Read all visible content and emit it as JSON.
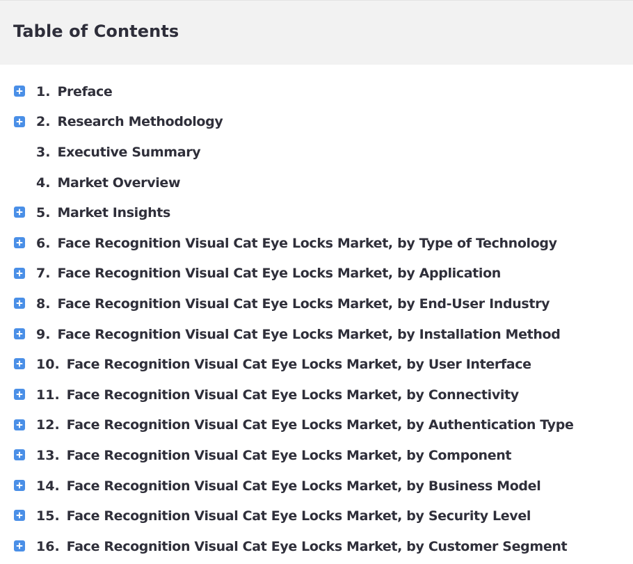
{
  "title": "Table of Contents",
  "accent_color": "#4a8fe7",
  "header_bg": "#f2f2f2",
  "toggle_icon": "plus-square-icon",
  "items": [
    {
      "num": "1.",
      "label": "Preface",
      "expandable": true
    },
    {
      "num": "2.",
      "label": "Research Methodology",
      "expandable": true
    },
    {
      "num": "3.",
      "label": "Executive Summary",
      "expandable": false
    },
    {
      "num": "4.",
      "label": "Market Overview",
      "expandable": false
    },
    {
      "num": "5.",
      "label": "Market Insights",
      "expandable": true
    },
    {
      "num": "6.",
      "label": "Face Recognition Visual Cat Eye Locks Market, by Type of Technology",
      "expandable": true
    },
    {
      "num": "7.",
      "label": "Face Recognition Visual Cat Eye Locks Market, by Application",
      "expandable": true
    },
    {
      "num": "8.",
      "label": "Face Recognition Visual Cat Eye Locks Market, by End-User Industry",
      "expandable": true
    },
    {
      "num": "9.",
      "label": "Face Recognition Visual Cat Eye Locks Market, by Installation Method",
      "expandable": true
    },
    {
      "num": "10.",
      "label": "Face Recognition Visual Cat Eye Locks Market, by User Interface",
      "expandable": true
    },
    {
      "num": "11.",
      "label": "Face Recognition Visual Cat Eye Locks Market, by Connectivity",
      "expandable": true
    },
    {
      "num": "12.",
      "label": "Face Recognition Visual Cat Eye Locks Market, by Authentication Type",
      "expandable": true
    },
    {
      "num": "13.",
      "label": "Face Recognition Visual Cat Eye Locks Market, by Component",
      "expandable": true
    },
    {
      "num": "14.",
      "label": "Face Recognition Visual Cat Eye Locks Market, by Business Model",
      "expandable": true
    },
    {
      "num": "15.",
      "label": "Face Recognition Visual Cat Eye Locks Market, by Security Level",
      "expandable": true
    },
    {
      "num": "16.",
      "label": "Face Recognition Visual Cat Eye Locks Market, by Customer Segment",
      "expandable": true
    }
  ]
}
